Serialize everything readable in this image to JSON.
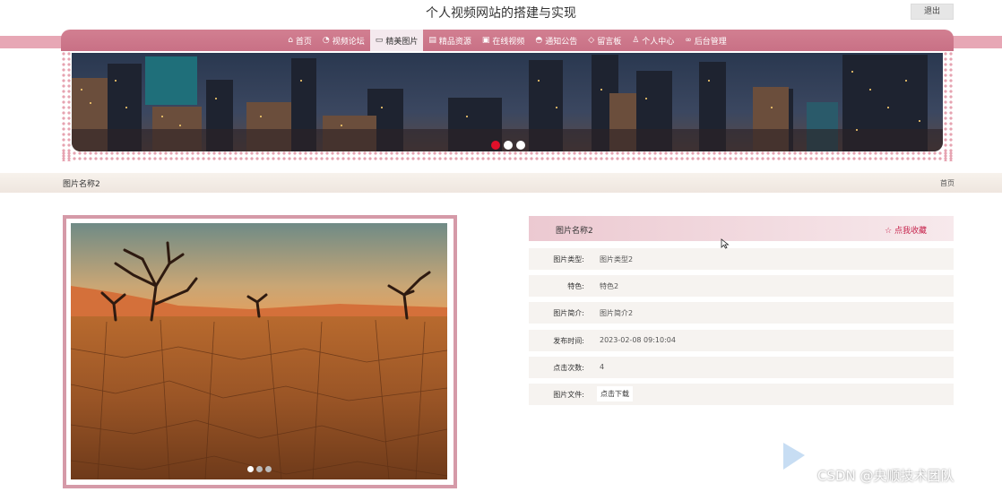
{
  "header": {
    "title": "个人视频网站的搭建与实现",
    "logout_label": "退出"
  },
  "nav": {
    "items": [
      {
        "label": "首页",
        "icon": "home-icon",
        "glyph": "⌂"
      },
      {
        "label": "视频论坛",
        "icon": "forum-icon",
        "glyph": "◔"
      },
      {
        "label": "精美图片",
        "icon": "image-icon",
        "glyph": "▭"
      },
      {
        "label": "精品资源",
        "icon": "resource-icon",
        "glyph": "▤"
      },
      {
        "label": "在线视频",
        "icon": "video-icon",
        "glyph": "▣"
      },
      {
        "label": "通知公告",
        "icon": "notice-icon",
        "glyph": "◓"
      },
      {
        "label": "留言板",
        "icon": "tag-icon",
        "glyph": "◇"
      },
      {
        "label": "个人中心",
        "icon": "user-icon",
        "glyph": "♙"
      },
      {
        "label": "后台管理",
        "icon": "link-icon",
        "glyph": "∞"
      }
    ],
    "active_index": 2
  },
  "banner": {
    "image": "city-night-skyline",
    "active_slide": 0,
    "slide_count": 3
  },
  "breadcrumb": {
    "title": "图片名称2",
    "home_label": "首页"
  },
  "picture": {
    "image": "cracked-desert-with-dead-trees",
    "active_slide": 0,
    "slide_count": 3
  },
  "detail": {
    "title": "图片名称2",
    "favorite_label": "☆ 点我收藏",
    "rows": [
      {
        "label": "图片类型:",
        "value": "图片类型2"
      },
      {
        "label": "特色:",
        "value": "特色2"
      },
      {
        "label": "图片简介:",
        "value": "图片简介2"
      },
      {
        "label": "发布时间:",
        "value": "2023-02-08 09:10:04"
      },
      {
        "label": "点击次数:",
        "value": "4"
      },
      {
        "label": "图片文件:",
        "button": "点击下载"
      }
    ]
  },
  "watermark": "CSDN @央顺技术团队",
  "colors": {
    "primary": "#c87085",
    "accent": "#d59aa8",
    "active_dot": "#e0102a",
    "favorite": "#c7254e"
  }
}
